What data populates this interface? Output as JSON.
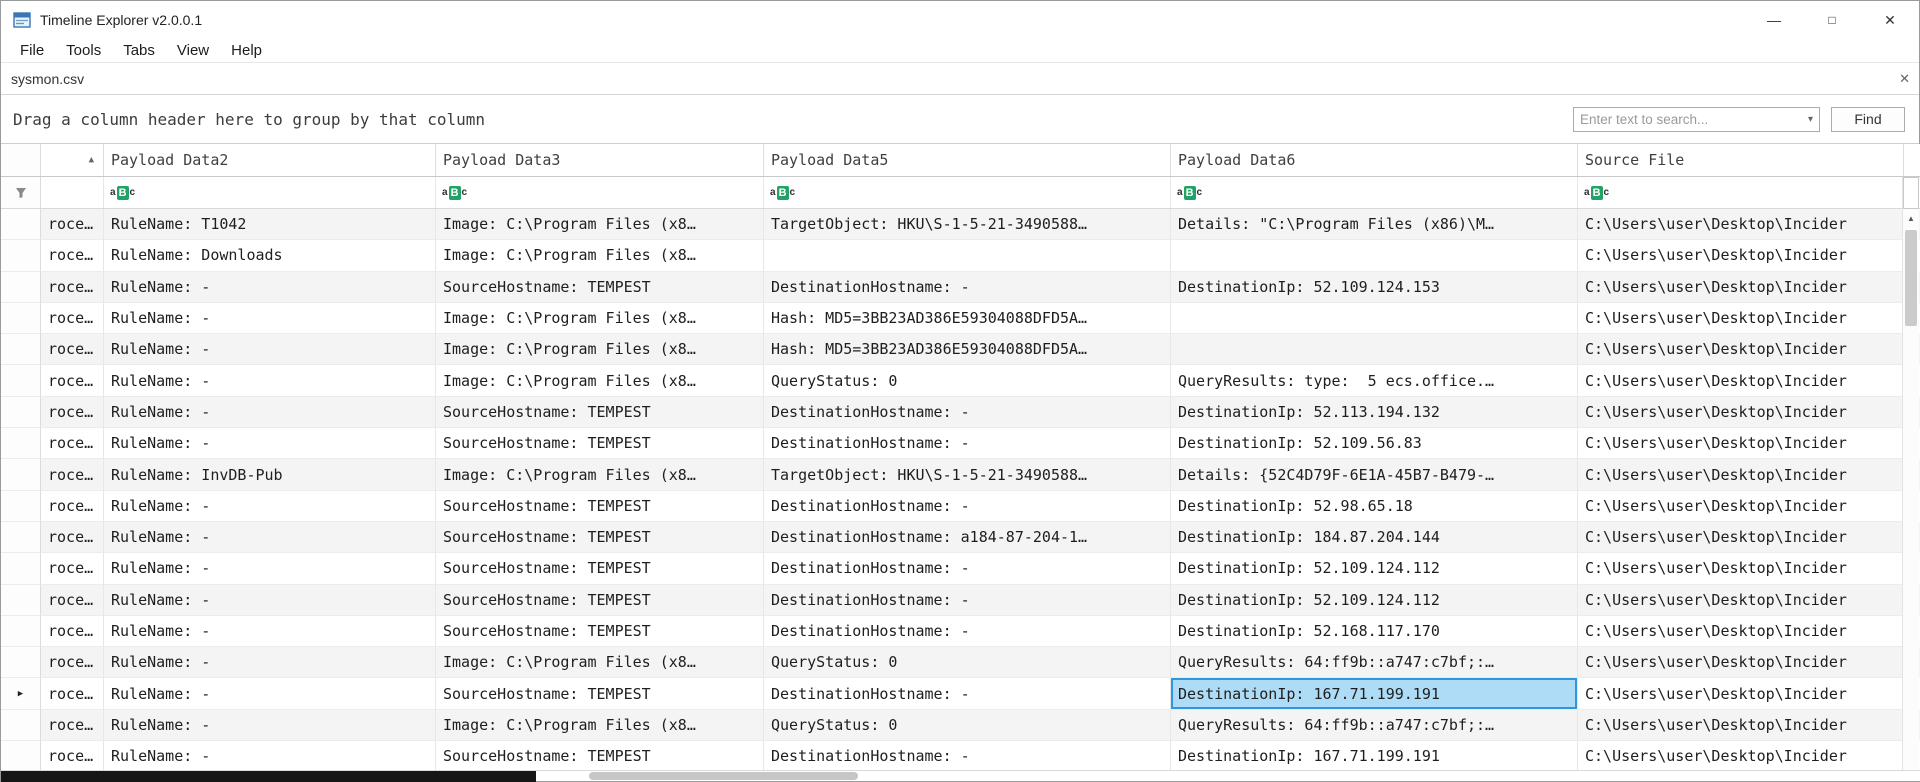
{
  "window": {
    "title": "Timeline Explorer v2.0.0.1"
  },
  "icons": {
    "minimize": "—",
    "maximize": "□",
    "close": "✕",
    "tab_close": "✕",
    "dropdown": "▾",
    "sort_asc": "▲",
    "row_arrow": "▶",
    "scroll_up": "▲",
    "filter_abc": "aBc"
  },
  "menu": {
    "items": [
      "File",
      "Tools",
      "Tabs",
      "View",
      "Help"
    ]
  },
  "tab": {
    "label": "sysmon.csv"
  },
  "group_panel": {
    "text": "Drag a column header here to group by that column"
  },
  "search": {
    "placeholder": "Enter text to search...",
    "find_label": "Find"
  },
  "colors": {
    "selection_bg": "#aedcf6",
    "selection_border": "#2e96dd",
    "filter_icon_green": "#21a366",
    "row_banding": "#f4f4f4"
  },
  "grid": {
    "columns": [
      {
        "label": "",
        "sorted": "asc",
        "filter_icon": false
      },
      {
        "label": "Payload Data2",
        "filter_icon": true
      },
      {
        "label": "Payload Data3",
        "filter_icon": true
      },
      {
        "label": "Payload Data5",
        "filter_icon": true
      },
      {
        "label": "Payload Data6",
        "filter_icon": true
      },
      {
        "label": "Source File",
        "filter_icon": true
      }
    ],
    "selected": {
      "row": 15,
      "col": 4
    },
    "rows": [
      [
        "roce…",
        "RuleName: T1042",
        "Image: C:\\Program Files (x8…",
        "TargetObject: HKU\\S-1-5-21-3490588…",
        "Details: \"C:\\Program Files (x86)\\M…",
        "C:\\Users\\user\\Desktop\\Incider"
      ],
      [
        "roce…",
        "RuleName: Downloads",
        "Image: C:\\Program Files (x8…",
        "",
        "",
        "C:\\Users\\user\\Desktop\\Incider"
      ],
      [
        "roce…",
        "RuleName: -",
        "SourceHostname: TEMPEST",
        "DestinationHostname: -",
        "DestinationIp: 52.109.124.153",
        "C:\\Users\\user\\Desktop\\Incider"
      ],
      [
        "roce…",
        "RuleName: -",
        "Image: C:\\Program Files (x8…",
        "Hash: MD5=3BB23AD386E59304088DFD5A…",
        "",
        "C:\\Users\\user\\Desktop\\Incider"
      ],
      [
        "roce…",
        "RuleName: -",
        "Image: C:\\Program Files (x8…",
        "Hash: MD5=3BB23AD386E59304088DFD5A…",
        "",
        "C:\\Users\\user\\Desktop\\Incider"
      ],
      [
        "roce…",
        "RuleName: -",
        "Image: C:\\Program Files (x8…",
        "QueryStatus: 0",
        "QueryResults: type:  5 ecs.office.…",
        "C:\\Users\\user\\Desktop\\Incider"
      ],
      [
        "roce…",
        "RuleName: -",
        "SourceHostname: TEMPEST",
        "DestinationHostname: -",
        "DestinationIp: 52.113.194.132",
        "C:\\Users\\user\\Desktop\\Incider"
      ],
      [
        "roce…",
        "RuleName: -",
        "SourceHostname: TEMPEST",
        "DestinationHostname: -",
        "DestinationIp: 52.109.56.83",
        "C:\\Users\\user\\Desktop\\Incider"
      ],
      [
        "roce…",
        "RuleName: InvDB-Pub",
        "Image: C:\\Program Files (x8…",
        "TargetObject: HKU\\S-1-5-21-3490588…",
        "Details: {52C4D79F-6E1A-45B7-B479-…",
        "C:\\Users\\user\\Desktop\\Incider"
      ],
      [
        "roce…",
        "RuleName: -",
        "SourceHostname: TEMPEST",
        "DestinationHostname: -",
        "DestinationIp: 52.98.65.18",
        "C:\\Users\\user\\Desktop\\Incider"
      ],
      [
        "roce…",
        "RuleName: -",
        "SourceHostname: TEMPEST",
        "DestinationHostname: a184-87-204-1…",
        "DestinationIp: 184.87.204.144",
        "C:\\Users\\user\\Desktop\\Incider"
      ],
      [
        "roce…",
        "RuleName: -",
        "SourceHostname: TEMPEST",
        "DestinationHostname: -",
        "DestinationIp: 52.109.124.112",
        "C:\\Users\\user\\Desktop\\Incider"
      ],
      [
        "roce…",
        "RuleName: -",
        "SourceHostname: TEMPEST",
        "DestinationHostname: -",
        "DestinationIp: 52.109.124.112",
        "C:\\Users\\user\\Desktop\\Incider"
      ],
      [
        "roce…",
        "RuleName: -",
        "SourceHostname: TEMPEST",
        "DestinationHostname: -",
        "DestinationIp: 52.168.117.170",
        "C:\\Users\\user\\Desktop\\Incider"
      ],
      [
        "roce…",
        "RuleName: -",
        "Image: C:\\Program Files (x8…",
        "QueryStatus: 0",
        "QueryResults: 64:ff9b::a747:c7bf;:…",
        "C:\\Users\\user\\Desktop\\Incider"
      ],
      [
        "roce…",
        "RuleName: -",
        "SourceHostname: TEMPEST",
        "DestinationHostname: -",
        "DestinationIp: 167.71.199.191",
        "C:\\Users\\user\\Desktop\\Incider"
      ],
      [
        "roce…",
        "RuleName: -",
        "Image: C:\\Program Files (x8…",
        "QueryStatus: 0",
        "QueryResults: 64:ff9b::a747:c7bf;:…",
        "C:\\Users\\user\\Desktop\\Incider"
      ],
      [
        "roce…",
        "RuleName: -",
        "SourceHostname: TEMPEST",
        "DestinationHostname: -",
        "DestinationIp: 167.71.199.191",
        "C:\\Users\\user\\Desktop\\Incider"
      ]
    ]
  }
}
